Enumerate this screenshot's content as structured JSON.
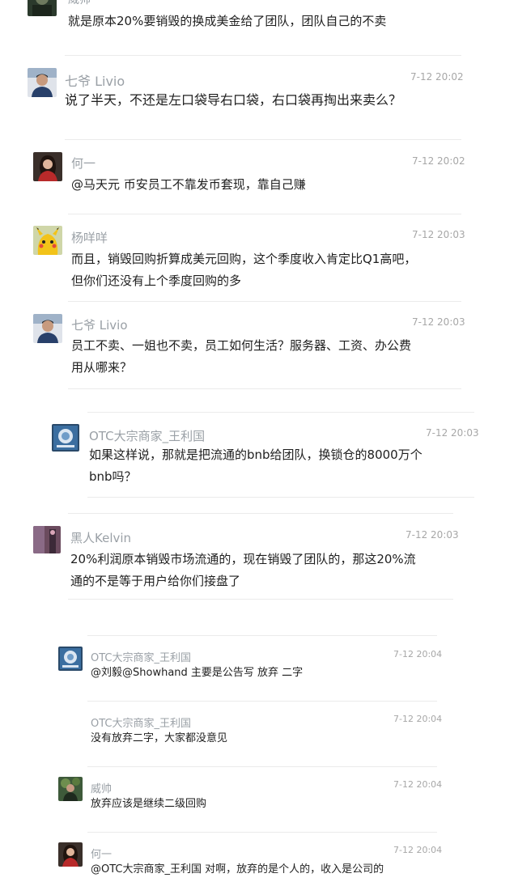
{
  "comments": [
    {
      "id": "c0",
      "name": "威帅",
      "time": "",
      "lines": [
        "就是原本20%要销毁的换成美金给了团队，团队自己的不卖"
      ]
    },
    {
      "id": "c1",
      "name": "七爷 Livio",
      "time": "7-12 20:02",
      "lines": [
        "说了半天，不还是左口袋导右口袋，右口袋再掏出来卖么？"
      ]
    },
    {
      "id": "c2",
      "name": "何一",
      "time": "7-12 20:02",
      "lines": [
        "@马天元 币安员工不靠发币套现，靠自己赚"
      ]
    },
    {
      "id": "c3",
      "name": "杨咩咩",
      "time": "7-12 20:03",
      "lines": [
        "而且，销毁回购折算成美元回购，这个季度收入肯定比Q1高吧，",
        "但你们还没有上个季度回购的多"
      ]
    },
    {
      "id": "c4",
      "name": "七爷 Livio",
      "time": "7-12 20:03",
      "lines": [
        "员工不卖、一姐也不卖，员工如何生活？服务器、工资、办公费",
        "用从哪来？"
      ]
    },
    {
      "id": "c5",
      "name": "OTC大宗商家_王利国",
      "time": "7-12 20:03",
      "lines": [
        "如果这样说，那就是把流通的bnb给团队，换锁仓的8000万个",
        "bnb吗？"
      ]
    },
    {
      "id": "c6",
      "name": "黑人Kelvin",
      "time": "7-12 20:03",
      "lines": [
        "20%利润原本销毁市场流通的，现在销毁了团队的，那这20%流",
        "通的不是等于用户给你们接盘了"
      ]
    },
    {
      "id": "c7",
      "name": "OTC大宗商家_王利国",
      "time": "7-12 20:04",
      "lines": [
        "@刘毅@Showhand 主要是公告写 放弃 二字"
      ]
    },
    {
      "id": "c8",
      "name": "OTC大宗商家_王利国",
      "time": "7-12 20:04",
      "lines": [
        "没有放弃二字，大家都没意见"
      ]
    },
    {
      "id": "c9",
      "name": "威帅",
      "time": "7-12 20:04",
      "lines": [
        "放弃应该是继续二级回购"
      ]
    },
    {
      "id": "c10",
      "name": "何一",
      "time": "7-12 20:04",
      "lines": [
        "@OTC大宗商家_王利国 对啊，放弃的是个人的，收入是公司的"
      ]
    }
  ]
}
